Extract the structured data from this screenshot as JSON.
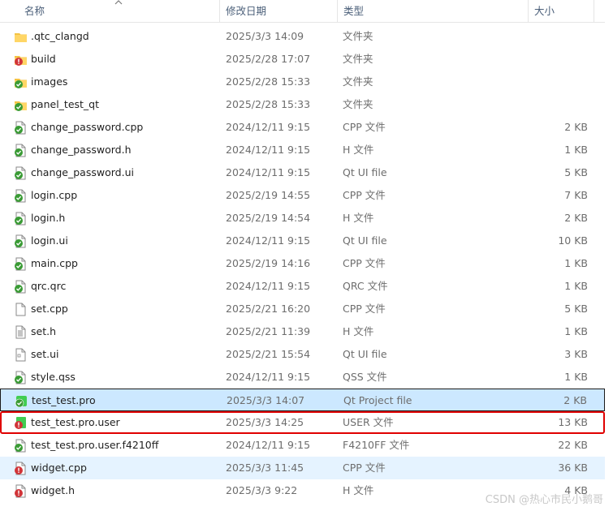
{
  "header": {
    "name": "名称",
    "date": "修改日期",
    "type": "类型",
    "size": "大小"
  },
  "files": [
    {
      "name": ".qtc_clangd",
      "date": "2025/3/3 14:09",
      "type": "文件夹",
      "size": "",
      "icon": "folder-icon"
    },
    {
      "name": "build",
      "date": "2025/2/28 17:07",
      "type": "文件夹",
      "size": "",
      "icon": "folder-error-icon"
    },
    {
      "name": "images",
      "date": "2025/2/28 15:33",
      "type": "文件夹",
      "size": "",
      "icon": "folder-synced-icon"
    },
    {
      "name": "panel_test_qt",
      "date": "2025/2/28 15:33",
      "type": "文件夹",
      "size": "",
      "icon": "folder-synced-icon"
    },
    {
      "name": "change_password.cpp",
      "date": "2024/12/11 9:15",
      "type": "CPP 文件",
      "size": "2 KB",
      "icon": "file-synced-icon"
    },
    {
      "name": "change_password.h",
      "date": "2024/12/11 9:15",
      "type": "H 文件",
      "size": "1 KB",
      "icon": "file-synced-icon"
    },
    {
      "name": "change_password.ui",
      "date": "2024/12/11 9:15",
      "type": "Qt UI file",
      "size": "5 KB",
      "icon": "file-synced-icon"
    },
    {
      "name": "login.cpp",
      "date": "2025/2/19 14:55",
      "type": "CPP 文件",
      "size": "7 KB",
      "icon": "file-synced-icon"
    },
    {
      "name": "login.h",
      "date": "2025/2/19 14:54",
      "type": "H 文件",
      "size": "2 KB",
      "icon": "file-synced-icon"
    },
    {
      "name": "login.ui",
      "date": "2024/12/11 9:15",
      "type": "Qt UI file",
      "size": "10 KB",
      "icon": "file-synced-icon"
    },
    {
      "name": "main.cpp",
      "date": "2025/2/19 14:16",
      "type": "CPP 文件",
      "size": "1 KB",
      "icon": "file-synced-icon"
    },
    {
      "name": "qrc.qrc",
      "date": "2024/12/11 9:15",
      "type": "QRC 文件",
      "size": "1 KB",
      "icon": "file-synced-icon"
    },
    {
      "name": "set.cpp",
      "date": "2025/2/21 16:20",
      "type": "CPP 文件",
      "size": "5 KB",
      "icon": "file-icon"
    },
    {
      "name": "set.h",
      "date": "2025/2/21 11:39",
      "type": "H 文件",
      "size": "1 KB",
      "icon": "file-text-icon"
    },
    {
      "name": "set.ui",
      "date": "2025/2/21 15:54",
      "type": "Qt UI file",
      "size": "3 KB",
      "icon": "file-ui-icon"
    },
    {
      "name": "style.qss",
      "date": "2024/12/11 9:15",
      "type": "QSS 文件",
      "size": "1 KB",
      "icon": "file-synced-icon"
    },
    {
      "name": "test_test.pro",
      "date": "2025/3/3 14:07",
      "type": "Qt Project file",
      "size": "2 KB",
      "icon": "qt-project-synced-icon",
      "state": "selected"
    },
    {
      "name": "test_test.pro.user",
      "date": "2025/3/3 14:25",
      "type": "USER 文件",
      "size": "13 KB",
      "icon": "file-user-error-icon",
      "state": "highlight-red"
    },
    {
      "name": "test_test.pro.user.f4210ff",
      "date": "2024/12/11 9:15",
      "type": "F4210FF 文件",
      "size": "22 KB",
      "icon": "file-synced-icon"
    },
    {
      "name": "widget.cpp",
      "date": "2025/3/3 11:45",
      "type": "CPP 文件",
      "size": "36 KB",
      "icon": "file-error-icon",
      "state": "hover"
    },
    {
      "name": "widget.h",
      "date": "2025/3/3 9:22",
      "type": "H 文件",
      "size": "4 KB",
      "icon": "file-error-icon"
    }
  ],
  "watermark": "CSDN @热心市民小鹅哥"
}
